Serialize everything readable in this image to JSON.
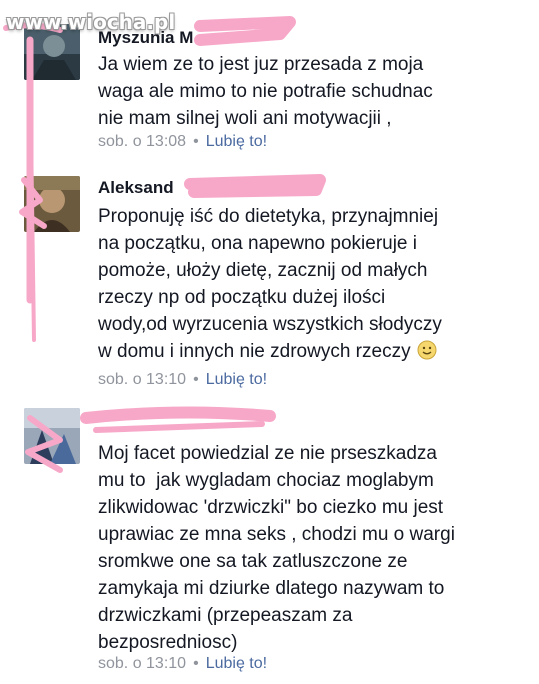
{
  "watermark": "www.wiocha.pl",
  "comments": [
    {
      "author": "Myszunia M",
      "lines": [
        "Ja wiem ze to jest juz przesada z moja",
        "waga ale mimo to nie potrafie schudnac",
        "nie mam silnej woli ani motywacjii ,"
      ],
      "time": "sob. o 13:08",
      "sep": "•",
      "like": "Lubię to!"
    },
    {
      "author": "Aleksand",
      "lines": [
        "Proponuję iść do dietetyka, przynajmniej",
        "na początku, ona napewno pokieruje i",
        "pomoże, ułoży dietę, zacznij od małych",
        "rzeczy np od początku dużej ilości",
        "wody,od wyrzucenia wszystkich słodyczy",
        "w domu i innych nie zdrowych rzeczy"
      ],
      "emoji": "smiley-emoji",
      "time": "sob. o 13:10",
      "sep": "•",
      "like": "Lubię to!"
    },
    {
      "author": "",
      "lines": [
        "Moj facet powiedzial ze nie prseszkadza",
        "mu to  jak wygladam chociaz moglabym",
        "zlikwidowac 'drzwiczki\" bo ciezko mu jest",
        "uprawiac ze mna seks , chodzi mu o wargi",
        "sromkwe one sa tak zatluszczone ze",
        "zamykaja mi dziurke dlatego nazywam to",
        "drzwiczkami (przepeaszam za",
        "bezposredniosc)"
      ],
      "time": "sob. o 13:10",
      "sep": "•",
      "like": "Lubię to!"
    }
  ],
  "colors": {
    "text": "#141823",
    "meta": "#90949c",
    "like": "#4b6aa0",
    "redaction": "#f7a8c8"
  }
}
